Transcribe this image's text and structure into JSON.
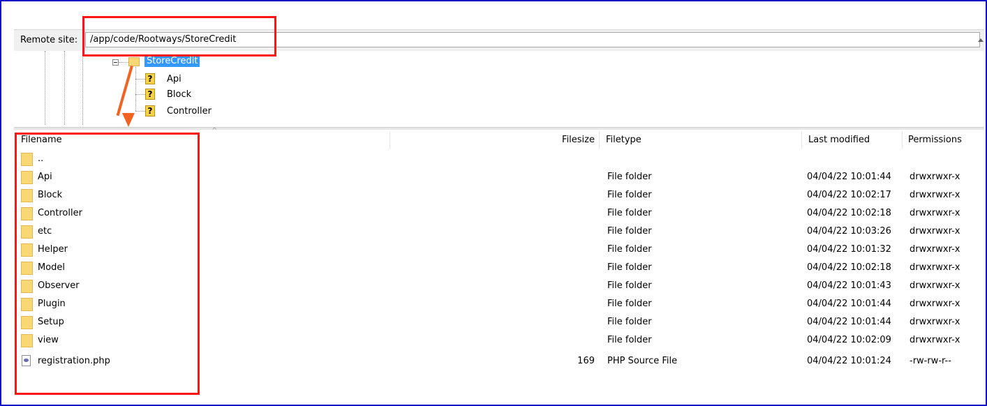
{
  "remote_site": {
    "label": "Remote site:",
    "path": "/app/code/Rootways/StoreCredit"
  },
  "tree": {
    "selected_folder": "StoreCredit",
    "children": [
      "Api",
      "Block",
      "Controller"
    ]
  },
  "columns": {
    "filename": "Filename",
    "filesize": "Filesize",
    "filetype": "Filetype",
    "last_modified": "Last modified",
    "permissions": "Permissions"
  },
  "files": [
    {
      "name": "..",
      "size": "",
      "type": "",
      "modified": "",
      "perms": "",
      "icon": "folder-icon"
    },
    {
      "name": "Api",
      "size": "",
      "type": "File folder",
      "modified": "04/04/22 10:01:44",
      "perms": "drwxrwxr-x",
      "icon": "folder-icon"
    },
    {
      "name": "Block",
      "size": "",
      "type": "File folder",
      "modified": "04/04/22 10:02:17",
      "perms": "drwxrwxr-x",
      "icon": "folder-icon"
    },
    {
      "name": "Controller",
      "size": "",
      "type": "File folder",
      "modified": "04/04/22 10:02:18",
      "perms": "drwxrwxr-x",
      "icon": "folder-icon"
    },
    {
      "name": "etc",
      "size": "",
      "type": "File folder",
      "modified": "04/04/22 10:03:26",
      "perms": "drwxrwxr-x",
      "icon": "folder-icon"
    },
    {
      "name": "Helper",
      "size": "",
      "type": "File folder",
      "modified": "04/04/22 10:01:32",
      "perms": "drwxrwxr-x",
      "icon": "folder-icon"
    },
    {
      "name": "Model",
      "size": "",
      "type": "File folder",
      "modified": "04/04/22 10:02:18",
      "perms": "drwxrwxr-x",
      "icon": "folder-icon"
    },
    {
      "name": "Observer",
      "size": "",
      "type": "File folder",
      "modified": "04/04/22 10:01:43",
      "perms": "drwxrwxr-x",
      "icon": "folder-icon"
    },
    {
      "name": "Plugin",
      "size": "",
      "type": "File folder",
      "modified": "04/04/22 10:01:44",
      "perms": "drwxrwxr-x",
      "icon": "folder-icon"
    },
    {
      "name": "Setup",
      "size": "",
      "type": "File folder",
      "modified": "04/04/22 10:01:44",
      "perms": "drwxrwxr-x",
      "icon": "folder-icon"
    },
    {
      "name": "view",
      "size": "",
      "type": "File folder",
      "modified": "04/04/22 10:02:09",
      "perms": "drwxrwxr-x",
      "icon": "folder-icon"
    },
    {
      "name": "registration.php",
      "size": "169",
      "type": "PHP Source File",
      "modified": "04/04/22 10:01:24",
      "perms": "-rw-rw-r--",
      "icon": "php-file-icon"
    }
  ],
  "colors": {
    "annotation_box": "#ff1414",
    "annotation_arrow": "#f26322",
    "selection": "#3399ff",
    "frame_border": "#1010c8",
    "folder": "#f8d775"
  }
}
